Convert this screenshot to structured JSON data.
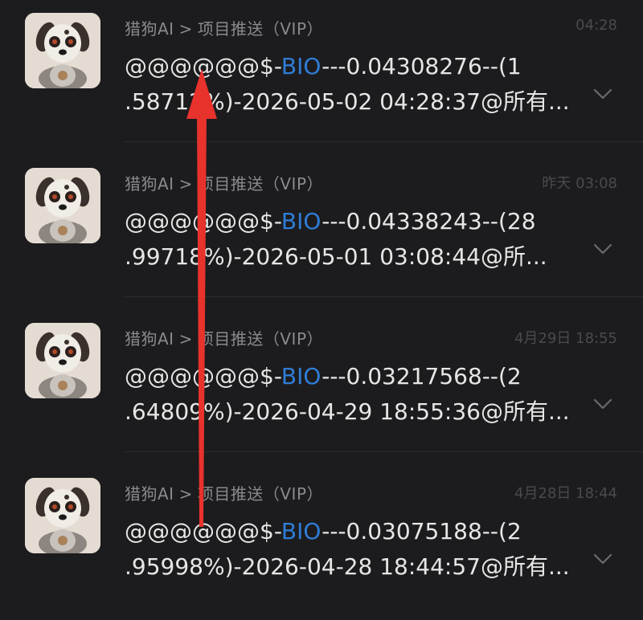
{
  "messages": [
    {
      "source": "猎狗AI",
      "separator": ">",
      "channel": "项目推送（VIP）",
      "time": "04:28",
      "line1_prefix": "@@@@@@$-",
      "ticker": "BIO",
      "line1_suffix": "---0.04308276--(1",
      "line2": ".58712%)-2026-05-02 04:28:37@所有..."
    },
    {
      "source": "猎狗AI",
      "separator": ">",
      "channel": "项目推送（VIP）",
      "time": "昨天 03:08",
      "line1_prefix": "@@@@@@$-",
      "ticker": "BIO",
      "line1_suffix": "---0.04338243--(28",
      "line2": ".99718%)-2026-05-01 03:08:44@所..."
    },
    {
      "source": "猎狗AI",
      "separator": ">",
      "channel": "项目推送（VIP）",
      "time": "4月29日 18:55",
      "line1_prefix": "@@@@@@$-",
      "ticker": "BIO",
      "line1_suffix": "---0.03217568--(2",
      "line2": ".64809%)-2026-04-29 18:55:36@所有..."
    },
    {
      "source": "猎狗AI",
      "separator": ">",
      "channel": "项目推送（VIP）",
      "time": "4月28日 18:44",
      "line1_prefix": "@@@@@@$-",
      "ticker": "BIO",
      "line1_suffix": "---0.03075188--(2",
      "line2": ".95998%)-2026-04-28 18:44:57@所有..."
    }
  ],
  "icons": {
    "avatar": "robot-dog-bitcoin-avatar-icon",
    "expand": "chevron-down-icon",
    "annotation": "red-up-arrow-annotation"
  },
  "colors": {
    "background": "#1c1c1e",
    "ticker": "#2f7dd6",
    "annotation": "#e8322c"
  }
}
